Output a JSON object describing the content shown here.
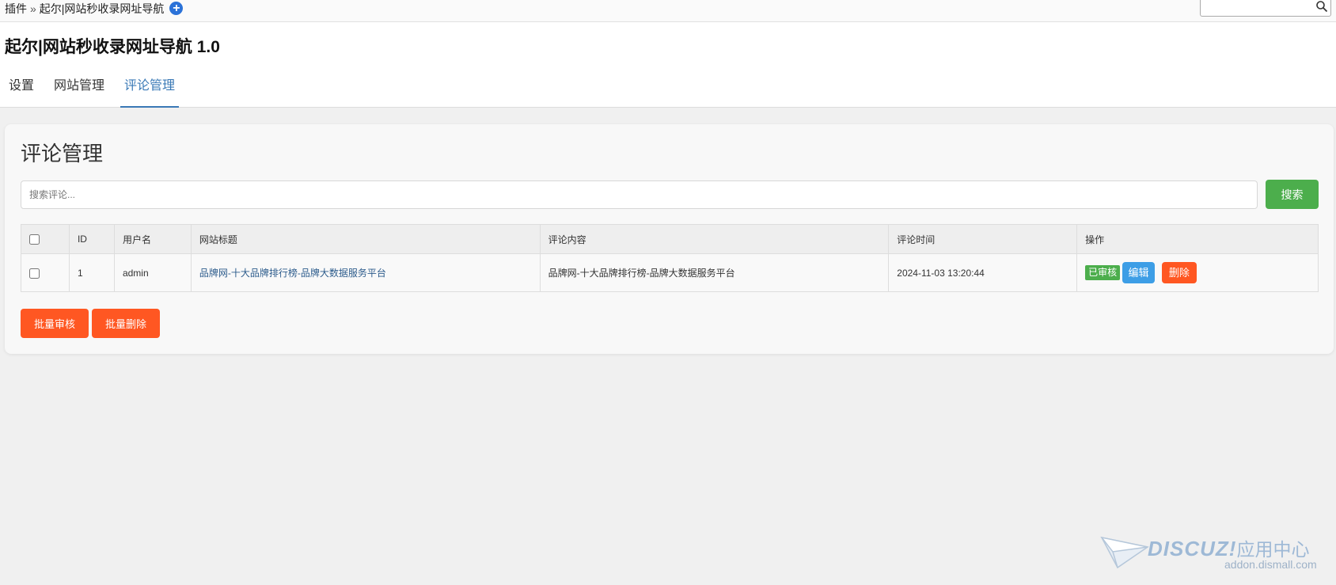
{
  "breadcrumb": {
    "root": "插件",
    "separator": "»",
    "current": "起尔|网站秒收录网址导航"
  },
  "top_search": {
    "value": "",
    "placeholder": ""
  },
  "header": {
    "title": "起尔|网站秒收录网址导航 1.0",
    "tabs": [
      {
        "label": "设置",
        "active": false
      },
      {
        "label": "网站管理",
        "active": false
      },
      {
        "label": "评论管理",
        "active": true
      }
    ]
  },
  "panel": {
    "title": "评论管理",
    "search_placeholder": "搜索评论...",
    "search_button": "搜索",
    "table": {
      "headers": [
        "",
        "ID",
        "用户名",
        "网站标题",
        "评论内容",
        "评论时间",
        "操作"
      ],
      "rows": [
        {
          "id": "1",
          "username": "admin",
          "site_title": "品牌网-十大品牌排行榜-品牌大数据服务平台",
          "content": "品牌网-十大品牌排行榜-品牌大数据服务平台",
          "time": "2024-11-03 13:20:44",
          "status": "已审核",
          "edit": "编辑",
          "delete": "删除"
        }
      ]
    },
    "bulk_approve": "批量审核",
    "bulk_delete": "批量删除"
  },
  "watermark": {
    "brand": "DISCUZ!",
    "brand_cn": "应用中心",
    "url": "addon.dismall.com"
  },
  "colors": {
    "accent_tab": "#3a79b6",
    "success": "#4cae4c",
    "primary": "#3d9ee6",
    "danger": "#ff5722"
  }
}
